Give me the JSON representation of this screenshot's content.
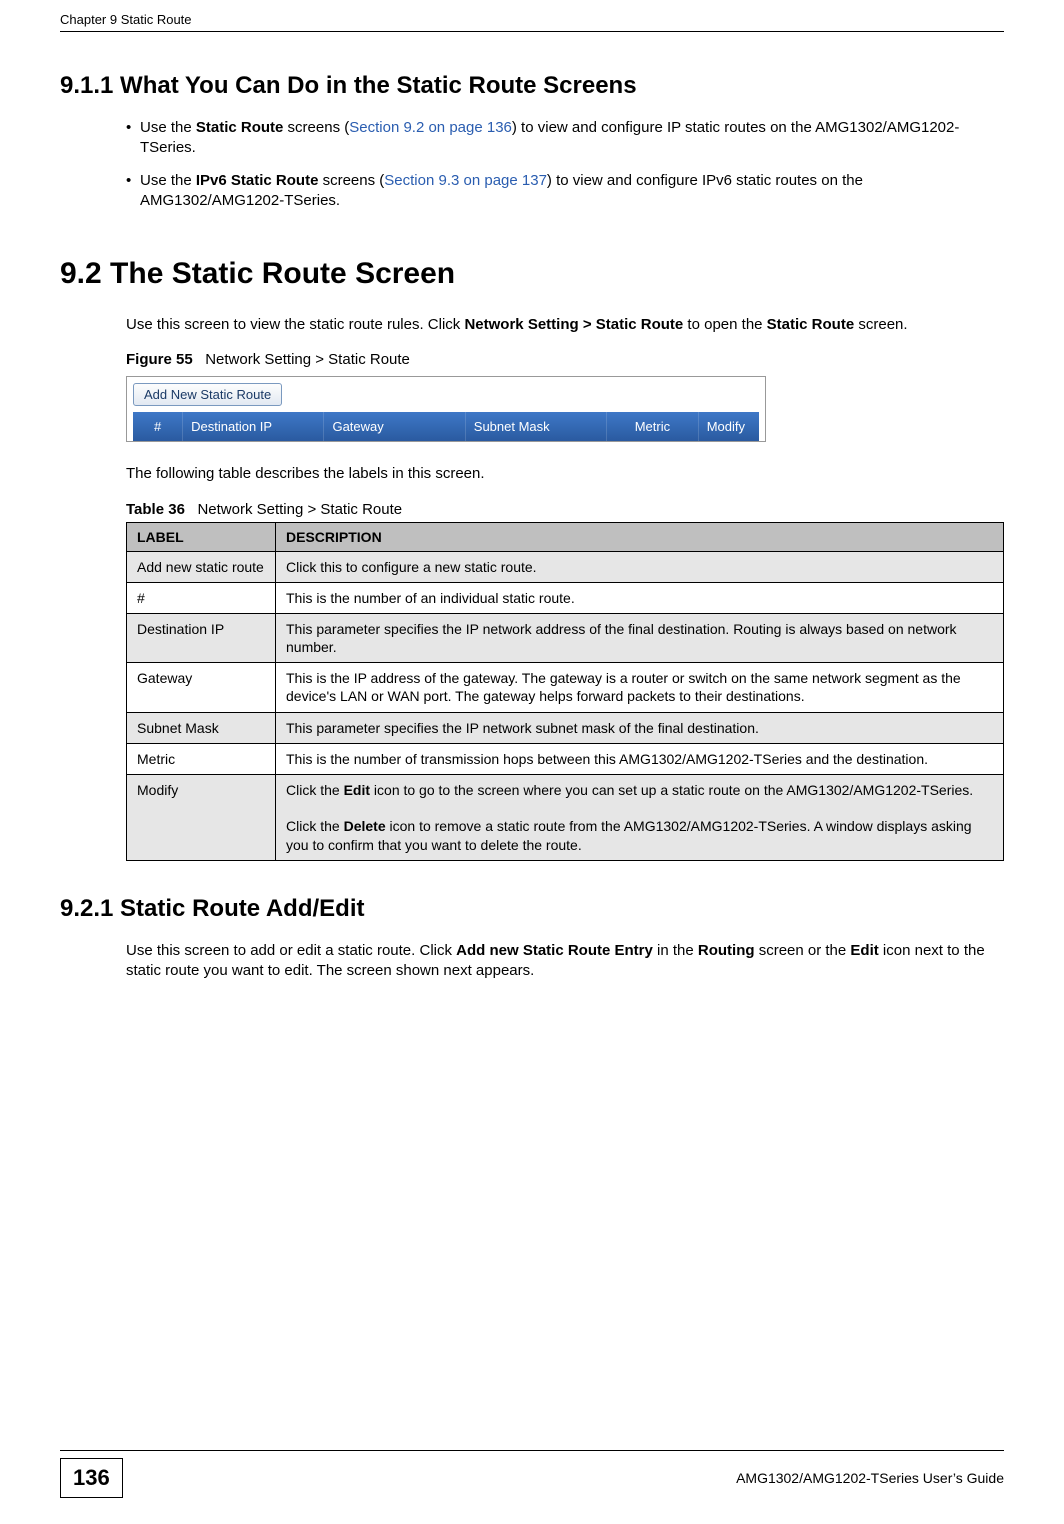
{
  "header": {
    "chapter": "Chapter 9 Static Route"
  },
  "sec_9_1_1": {
    "title": "9.1.1  What You Can Do in the Static Route Screens",
    "b1_pre": "Use the ",
    "b1_bold": "Static Route",
    "b1_mid": " screens (",
    "b1_link": "Section 9.2 on page 136",
    "b1_post": ") to view and configure IP static routes on the AMG1302/AMG1202-TSeries.",
    "b2_pre": "Use the ",
    "b2_bold": "IPv6 Static Route",
    "b2_mid": " screens (",
    "b2_link": "Section 9.3 on page 137",
    "b2_post": ") to view and configure IPv6 static routes on the AMG1302/AMG1202-TSeries."
  },
  "sec_9_2": {
    "title": "9.2  The Static Route Screen",
    "para1_pre": "Use this screen to view the static route rules. Click ",
    "para1_bold1": "Network Setting > Static Route",
    "para1_mid": " to open the ",
    "para1_bold2": "Static Route",
    "para1_post": " screen.",
    "fig_label": "Figure 55",
    "fig_title": "Network Setting > Static Route",
    "fig_button": "Add New Static Route",
    "fig_cols": {
      "hash": "#",
      "dest": "Destination IP",
      "gw": "Gateway",
      "mask": "Subnet Mask",
      "metric": "Metric",
      "modify": "Modify"
    },
    "after_fig": "The following table describes the labels in this screen.",
    "tbl_label": "Table 36",
    "tbl_title": "Network Setting > Static Route",
    "tbl_head_label": "LABEL",
    "tbl_head_desc": "DESCRIPTION",
    "rows": [
      {
        "label": "Add new static route",
        "desc": "Click this to configure a new static route."
      },
      {
        "label": "#",
        "desc": "This is the number of an individual static route."
      },
      {
        "label": "Destination IP",
        "desc": "This parameter specifies the IP network address of the final destination. Routing is always based on network number."
      },
      {
        "label": "Gateway",
        "desc": "This is the IP address of the gateway. The gateway is a router or switch on the same network segment as the device's LAN or WAN port. The gateway helps forward packets to their destinations."
      },
      {
        "label": "Subnet Mask",
        "desc": "This parameter specifies the IP network subnet mask of the final destination."
      },
      {
        "label": "Metric",
        "desc": "This is the number of transmission hops between this AMG1302/AMG1202-TSeries and the destination."
      }
    ],
    "modify_row": {
      "label": "Modify",
      "p1_pre": "Click the ",
      "p1_bold": "Edit",
      "p1_post": " icon to go to the screen where you can set up a static route on the AMG1302/AMG1202-TSeries.",
      "p2_pre": "Click the ",
      "p2_bold": "Delete",
      "p2_post": " icon to remove a static route from the AMG1302/AMG1202-TSeries. A window displays asking you to confirm that you want to delete the route."
    }
  },
  "sec_9_2_1": {
    "title": "9.2.1  Static Route Add/Edit",
    "p_pre": "Use this screen to add or edit a static route. Click ",
    "p_b1": "Add new Static Route Entry",
    "p_mid1": " in the ",
    "p_b2": "Routing",
    "p_mid2": " screen or the ",
    "p_b3": "Edit",
    "p_post": " icon next to the static route you want to edit. The screen shown next appears."
  },
  "footer": {
    "page": "136",
    "guide": "AMG1302/AMG1202-TSeries User’s Guide"
  }
}
